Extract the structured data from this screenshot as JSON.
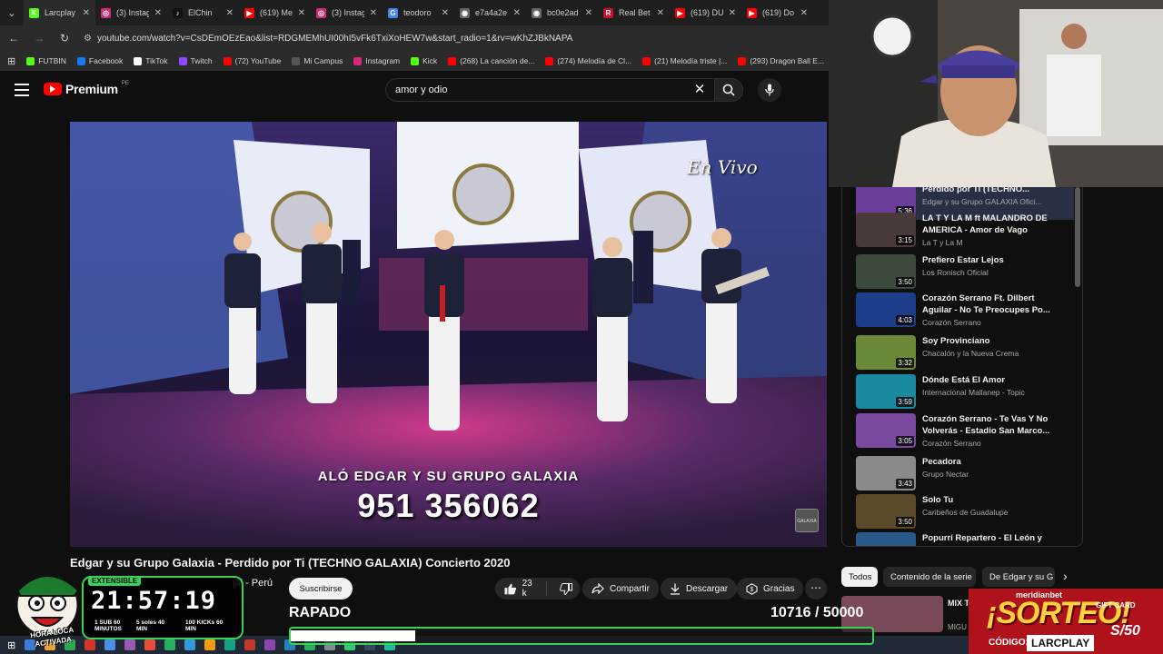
{
  "browser": {
    "tabs": [
      {
        "label": "Larcplay",
        "color": "#53fc18",
        "glyph": "K"
      },
      {
        "label": "(3) Instag",
        "color": "#d62976",
        "glyph": "◎"
      },
      {
        "label": "ElChin",
        "color": "#111111",
        "glyph": "♪"
      },
      {
        "label": "(619) Me",
        "color": "#ff0000",
        "glyph": "▶"
      },
      {
        "label": "(3) Instag",
        "color": "#d62976",
        "glyph": "◎"
      },
      {
        "label": "teodoro",
        "color": "#4285f4",
        "glyph": "G"
      },
      {
        "label": "e7a4a2e",
        "color": "#666666",
        "glyph": "◉"
      },
      {
        "label": "bc0e2ad",
        "color": "#666666",
        "glyph": "◉"
      },
      {
        "label": "Real Bet",
        "color": "#c8102e",
        "glyph": "R"
      },
      {
        "label": "(619) DU",
        "color": "#ff0000",
        "glyph": "▶"
      },
      {
        "label": "(619) Do",
        "color": "#ff0000",
        "glyph": "▶"
      }
    ],
    "url": "youtube.com/watch?v=CsDEmOEzEao&list=RDGMEMhUI00hI5vFk6TxiXoHEW7w&start_radio=1&rv=wKhZJBkNAPA",
    "bookmarks": [
      {
        "label": "FUTBIN",
        "color": "#53fc18"
      },
      {
        "label": "Facebook",
        "color": "#1877f2"
      },
      {
        "label": "TikTok",
        "color": "#ffffff"
      },
      {
        "label": "Twitch",
        "color": "#9146ff"
      },
      {
        "label": "(72) YouTube",
        "color": "#ff0000"
      },
      {
        "label": "Mi Campus",
        "color": "#555555"
      },
      {
        "label": "Instagram",
        "color": "#d62976"
      },
      {
        "label": "Kick",
        "color": "#53fc18"
      },
      {
        "label": "(268) La canción de...",
        "color": "#ff0000"
      },
      {
        "label": "(274) Melodía de Cl...",
        "color": "#ff0000"
      },
      {
        "label": "(21) Melodía triste |...",
        "color": "#ff0000"
      },
      {
        "label": "(293) Dragon Ball E...",
        "color": "#ff0000"
      }
    ]
  },
  "youtube": {
    "logo_text": "Premium",
    "country_code": "PE",
    "search_value": "amor y odio",
    "video": {
      "overlay_top_right": "En Vivo",
      "overlay_line1": "ALÓ EDGAR Y SU GRUPO GALAXIA",
      "overlay_line2": "951 356062",
      "watermark": "GALAXIA",
      "title": "Edgar y su Grupo Galaxia - Perdido por Ti (TECHNO GALAXIA) Concierto 2020",
      "channel_fragment": "ial - Perú",
      "subscribe_label": "Suscribirse",
      "likes": "23 k",
      "share_label": "Compartir",
      "download_label": "Descargar",
      "thanks_label": "Gracias"
    },
    "playlist": [
      {
        "title": "Perdido por Ti (TECHNO...",
        "channel": "Edgar y su Grupo GALAXIA Ofici...",
        "duration": "5:36",
        "thumb": "#6a3d9a",
        "active": true
      },
      {
        "title": "LA T Y LA M ft MALANDRO DE AMERICA - Amor de Vago",
        "channel": "La T y La M",
        "duration": "3:15",
        "thumb": "#4a3b3b"
      },
      {
        "title": "Prefiero Estar Lejos",
        "channel": "Los Ronisch Oficial",
        "duration": "3:50",
        "thumb": "#3b4a3a"
      },
      {
        "title": "Corazón Serrano Ft. Dilbert Aguilar - No Te Preocupes Po...",
        "channel": "Corazón Serrano",
        "duration": "4:03",
        "thumb": "#1d3e8a"
      },
      {
        "title": "Soy Provinciano",
        "channel": "Chacalón y la Nueva Crema",
        "duration": "3:32",
        "thumb": "#6a8a3a"
      },
      {
        "title": "Dónde Está El Amor",
        "channel": "Internacional Mallanep - Topic",
        "duration": "3:59",
        "thumb": "#1a8aa0"
      },
      {
        "title": "Corazón Serrano - Te Vas Y No Volverás - Estadio San Marco...",
        "channel": "Corazón Serrano",
        "duration": "3:05",
        "thumb": "#7a4aa0"
      },
      {
        "title": "Pecadora",
        "channel": "Grupo Nectar",
        "duration": "3:43",
        "thumb": "#8a8a8a"
      },
      {
        "title": "Solo Tu",
        "channel": "Caribeños de Guadalupe",
        "duration": "3:50",
        "thumb": "#5a4a2a"
      },
      {
        "title": "Popurrí Repartero - El León y",
        "channel": "",
        "duration": "",
        "thumb": "#2a5a8a"
      }
    ],
    "chips": [
      "Todos",
      "Contenido de la serie",
      "De Edgar y su G"
    ],
    "next_rec_title": "MIX T DUKE",
    "next_rec_sub": "MIGU"
  },
  "stream_overlay": {
    "timer_badge": "EXTENSIBLE",
    "timer": "21:57:19",
    "info": [
      "1 SUB 60 MINUTOS",
      "5 soles 40 MIN",
      "100 KICKs 60 MIN"
    ],
    "mascot_label": "HORA LOCA ACTIVADA",
    "goal_title": "RAPADO",
    "goal_current": "10716",
    "goal_target": "/ 50000",
    "goal_fraction": 0.214,
    "goal_color": "#3ad15a"
  },
  "sponsor": {
    "brand": "meridianbet",
    "headline": "¡SORTEO!",
    "code_label": "CÓDIGO:",
    "code": "LARCPLAY",
    "gift_label": "GIFT CARD",
    "gift_amount": "S/50"
  }
}
